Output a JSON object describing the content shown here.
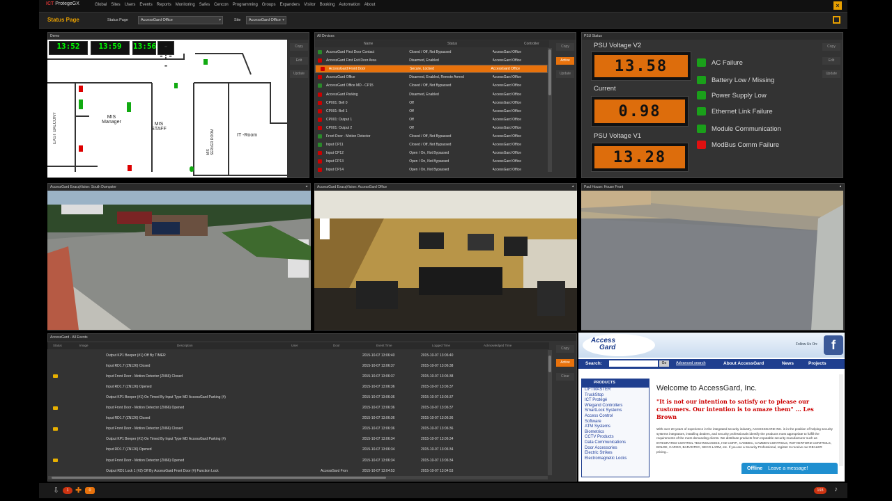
{
  "app": {
    "logo_mark": "ICT",
    "logo_text": "ProtegeGX",
    "menu": [
      "Global",
      "Sites",
      "Users",
      "Events",
      "Reports",
      "Monitoring",
      "Safes",
      "Cencon",
      "Programming",
      "Groups",
      "Expanders",
      "Visitor",
      "Booking",
      "Automation",
      "About"
    ]
  },
  "status": {
    "title": "Status Page",
    "page_label": "Status Page",
    "page_value": "AccessGard Office",
    "site_label": "Site",
    "site_value": "AccessGard Office"
  },
  "buttons": {
    "copy": "Copy",
    "edit": "Edit",
    "update": "Update",
    "active": "Active",
    "clear": "Clear"
  },
  "demo": {
    "title": "Demo",
    "clocks": [
      "13:52",
      "13:59",
      "13:56",
      "--:--"
    ],
    "rooms": {
      "balcony": "EAST BALCONY",
      "manager": "MIS\nManager",
      "staff": "MIS\nSTAFF",
      "server": "MIS\nSERVER ROOM",
      "it": "IT -Room"
    }
  },
  "devices": {
    "title": "All Devices",
    "col_name": "Name",
    "col_status": "Status",
    "col_controller": "Controller",
    "rows": [
      {
        "name": "AccessGard First Door Contact",
        "status": "Closed / Off, Not Bypassed",
        "controller": "AccessGard Office",
        "color": "#2a8a2a",
        "selected": false
      },
      {
        "name": "AccessGard First Exit Door Area",
        "status": "Disarmed, Enabled",
        "controller": "AccessGard Office",
        "color": "#c00",
        "selected": false
      },
      {
        "name": "AccessGard Front Door",
        "status": "Secure, Locked",
        "controller": "AccessGard Office",
        "color": "#c00",
        "selected": true
      },
      {
        "name": "AccessGard Office",
        "status": "Disarmed, Enabled, Remote Armed",
        "controller": "AccessGard Office",
        "color": "#c00",
        "selected": false
      },
      {
        "name": "AccessGard Office MD - CP15",
        "status": "Closed / Off, Not Bypassed",
        "controller": "AccessGard Office",
        "color": "#2a8a2a",
        "selected": false
      },
      {
        "name": "AccessGard Parking",
        "status": "Disarmed, Enabled",
        "controller": "AccessGard Office",
        "color": "#c00",
        "selected": false
      },
      {
        "name": "CP001: Bell 0",
        "status": "Off",
        "controller": "AccessGard Office",
        "color": "#c00",
        "selected": false
      },
      {
        "name": "CP001: Bell 1",
        "status": "Off",
        "controller": "AccessGard Office",
        "color": "#c00",
        "selected": false
      },
      {
        "name": "CP001: Output 1",
        "status": "Off",
        "controller": "AccessGard Office",
        "color": "#c00",
        "selected": false
      },
      {
        "name": "CP001: Output 2",
        "status": "Off",
        "controller": "AccessGard Office",
        "color": "#c00",
        "selected": false
      },
      {
        "name": "Front Door - Motion Detector",
        "status": "Closed / Off, Not Bypassed",
        "controller": "AccessGard Office",
        "color": "#2a8a2a",
        "selected": false
      },
      {
        "name": "Input CP11",
        "status": "Closed / Off, Not Bypassed",
        "controller": "AccessGard Office",
        "color": "#2a8a2a",
        "selected": false
      },
      {
        "name": "Input CP12",
        "status": "Open / On, Not Bypassed",
        "controller": "AccessGard Office",
        "color": "#c00",
        "selected": false
      },
      {
        "name": "Input CP13",
        "status": "Open / On, Not Bypassed",
        "controller": "AccessGard Office",
        "color": "#c00",
        "selected": false
      },
      {
        "name": "Input CP14",
        "status": "Open / On, Not Bypassed",
        "controller": "AccessGard Office",
        "color": "#c00",
        "selected": false
      }
    ]
  },
  "psu": {
    "title": "PSU Status",
    "v2_label": "PSU Voltage V2",
    "current_label": "Current",
    "v1_label": "PSU Voltage V1",
    "v2_value": "13.58",
    "current_value": "0.98",
    "v1_value": "13.28",
    "alarms": [
      {
        "label": "AC Failure",
        "color": "#1aa01a"
      },
      {
        "label": "Battery Low / Missing",
        "color": "#1aa01a"
      },
      {
        "label": "Power Supply Low",
        "color": "#1aa01a"
      },
      {
        "label": "Ethernet Link Failure",
        "color": "#1aa01a"
      },
      {
        "label": "Module Communication",
        "color": "#1aa01a"
      },
      {
        "label": "ModBus  Comm Failure",
        "color": "#e01010"
      }
    ]
  },
  "cameras": [
    {
      "title": "AccessGard ExacqVision: South Dumpster"
    },
    {
      "title": "AccessGard ExacqVision: AccessGard Office"
    },
    {
      "title": "Paul House: House Front"
    }
  ],
  "events": {
    "title": "AccessGard - All Events",
    "cols": [
      "Status",
      "Image",
      "Description",
      "User",
      "Door",
      "Event Time",
      "Logged Time",
      "Acknowledged Time"
    ],
    "rows": [
      {
        "desc": "Output KP1 Beeper (#1) Off By TIMER",
        "t1": "2015-10-07 13:06:40",
        "t2": "2015-10-07 13:06:40",
        "flag": false
      },
      {
        "desc": "Input RD1.7 (ZN126) Closed",
        "t1": "2015-10-07 13:06:37",
        "t2": "2015-10-07 13:06:38",
        "flag": false
      },
      {
        "desc": "Input Front Door - Motion Detector (ZN66) Closed",
        "t1": "2015-10-07 13:06:37",
        "t2": "2015-10-07 13:06:38",
        "flag": true
      },
      {
        "desc": "Input RD1.7 (ZN126) Opened",
        "t1": "2015-10-07 13:06:36",
        "t2": "2015-10-07 13:06:37",
        "flag": false
      },
      {
        "desc": "Output KP1 Beeper (#1) On Timed By Input Type MD AccessGard Parking (#)",
        "t1": "2015-10-07 13:06:36",
        "t2": "2015-10-07 13:06:37",
        "flag": false
      },
      {
        "desc": "Input Front Door - Motion Detector (ZN66) Opened",
        "t1": "2015-10-07 13:06:36",
        "t2": "2015-10-07 13:06:37",
        "flag": true
      },
      {
        "desc": "Input RD1.7 (ZN126) Closed",
        "t1": "2015-10-07 13:06:36",
        "t2": "2015-10-07 13:06:36",
        "flag": false
      },
      {
        "desc": "Input Front Door - Motion Detector (ZN66) Closed",
        "t1": "2015-10-07 13:06:36",
        "t2": "2015-10-07 13:06:36",
        "flag": true
      },
      {
        "desc": "Output KP1 Beeper (#1) On Timed By Input Type MD AccessGard Parking (#)",
        "t1": "2015-10-07 13:06:34",
        "t2": "2015-10-07 13:06:34",
        "flag": false
      },
      {
        "desc": "Input RD1.7 (ZN126) Opened",
        "t1": "2015-10-07 13:06:34",
        "t2": "2015-10-07 13:06:34",
        "flag": false
      },
      {
        "desc": "Input Front Door - Motion Detector (ZN66) Opened",
        "t1": "2015-10-07 13:06:34",
        "t2": "2015-10-07 13:06:34",
        "flag": true
      },
      {
        "desc": "Output RD1 Lock 1 (#2) Off By AccessGard Front Door (#) Function Lock",
        "t1": "2015-10-07 13:04:53",
        "t2": "2015-10-07 13:04:53",
        "door": "AccessGard Fron",
        "flag": false
      }
    ]
  },
  "web": {
    "brand_top": "Access",
    "brand_bottom": "Gard",
    "follow": "Follow Us On:",
    "search_label": "Search:",
    "go": "Go",
    "adv": "Advanced search",
    "nav": [
      "About AccessGard",
      "News",
      "Projects"
    ],
    "products_title": "PRODUCTS",
    "products": [
      "LIFTMASTER",
      "TruckStop",
      "ICT Protégé",
      "Wiegand Controllers",
      "SmartLock Systems",
      "Access Control",
      "Software",
      "ATM Systems",
      "Biometrics",
      "CCTV Products",
      "Data Communications",
      "Door Accessories",
      "Electric Strikes",
      "Electromagnetic Locks"
    ],
    "welcome": "Welcome to AccessGard, Inc.",
    "quote": "\"It is not our intention to satisfy or to please our customers. Our intention is to amaze them\" ... Les Brown",
    "body": "With over 20 years of experience in the integrated security industry, ACCESSGARD INC. is in the position of helping security systems integrators, installing dealers, and security professionals identify the products most appropriate to fulfill the requirements of the most demanding clients. We distribute products from reputable security manufacturer such as INTEGRATED CONTROL TECHNOLOGIES, HID CORP., CAMDEC, CAMDEN CONTROLS, ROTHERFORD CONTROLS, BOLDE, CARGO, BARANTEC, SECO-LARM, etc. If you are a Security Professional, register to receive our DEALER pricing...",
    "chat_status": "Offline",
    "chat_text": "Leave a message!"
  },
  "bottom": {
    "count1": "1",
    "count2": "0",
    "count3": "193"
  }
}
